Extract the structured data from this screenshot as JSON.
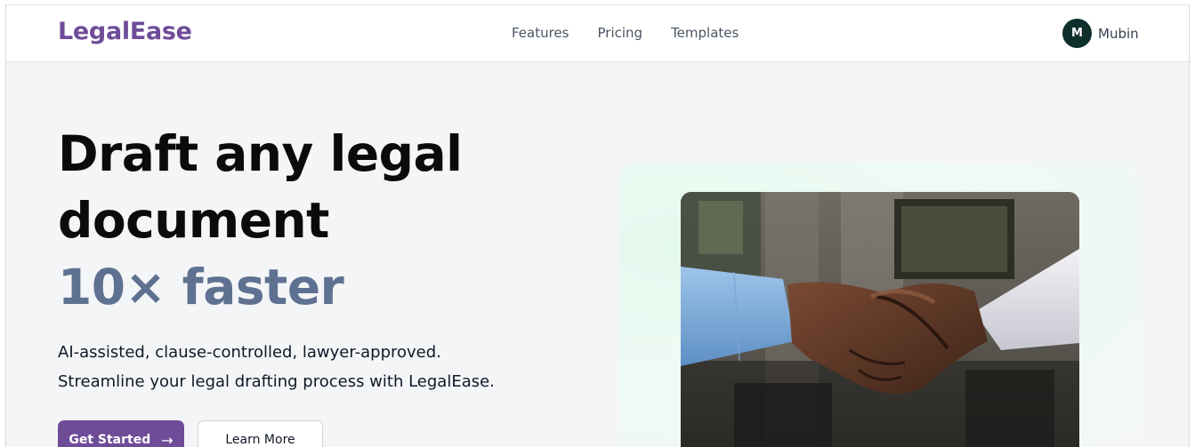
{
  "header": {
    "brand": "LegalEase",
    "nav": [
      {
        "label": "Features"
      },
      {
        "label": "Pricing"
      },
      {
        "label": "Templates"
      }
    ],
    "user": {
      "initial": "M",
      "name": "Mubin"
    }
  },
  "hero": {
    "title_line1": "Draft any legal",
    "title_line2": "document",
    "title_accent": "10× faster",
    "subtitle_line1": "AI-assisted, clause-controlled, lawyer-approved.",
    "subtitle_line2": "Streamline your legal drafting process with LegalEase.",
    "primary_button": {
      "label": "Get Started",
      "arrow": "→"
    },
    "secondary_button": {
      "label": "Learn More"
    }
  },
  "image": {
    "subject": "handshake-photo"
  },
  "colors": {
    "brand": "#6f4c98",
    "accent_text": "#5f7190",
    "avatar": "#0f2f2c",
    "page_bg": "#f4f5f7"
  }
}
